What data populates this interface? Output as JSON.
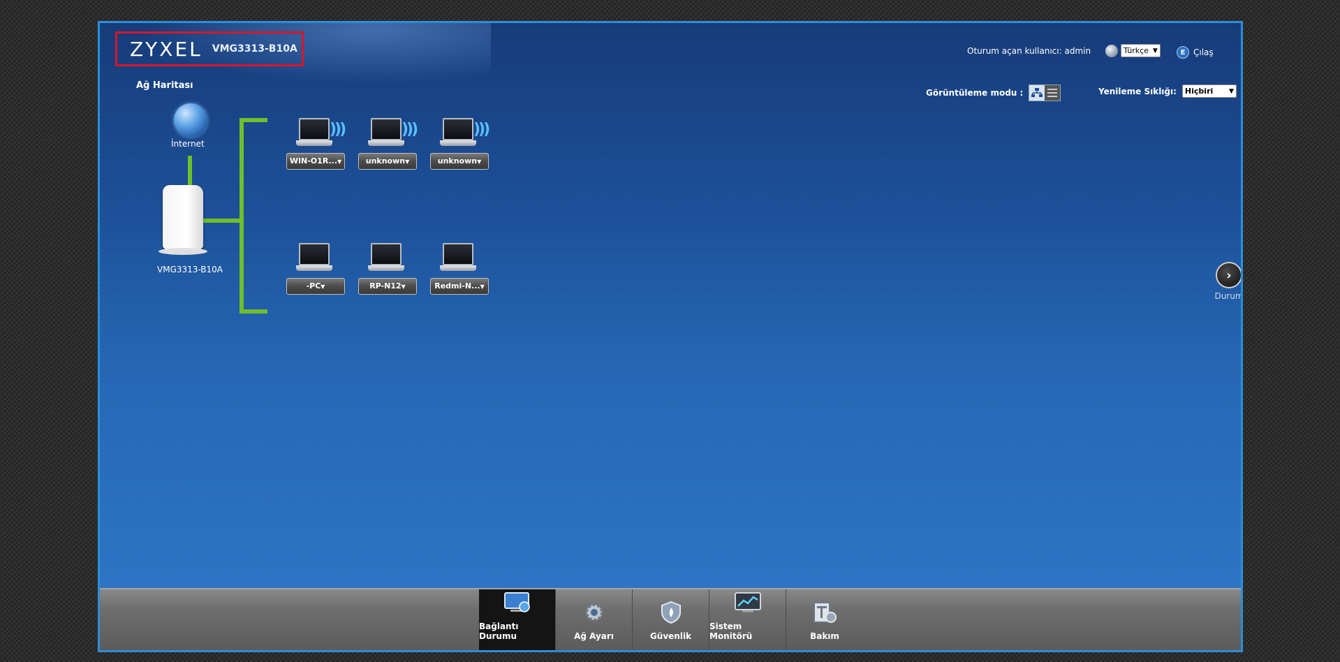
{
  "header": {
    "brand": "ZYXEL",
    "model": "VMG3313-B10A",
    "logged_in_text": "Oturum açan kullanıcı: admin",
    "language_selected": "Türkçe",
    "logout_label": "Çılaş"
  },
  "map": {
    "title": "Ağ Haritası",
    "view_mode_label": "Görüntüleme modu :",
    "refresh_label": "Yenileme Sıklığı:",
    "refresh_selected": "Hiçbiri",
    "internet_label": "İnternet",
    "router_label": "VMG3313-B10A",
    "wireless_devices": [
      "WIN-O1R...",
      "unknown",
      "unknown"
    ],
    "wired_devices": [
      "-PC",
      "RP-N12",
      "Redmi-N..."
    ]
  },
  "side": {
    "status_label": "Durum"
  },
  "nav": {
    "items": [
      {
        "label": "Bağlantı Durumu",
        "icon": "connection-status-icon"
      },
      {
        "label": "Ağ Ayarı",
        "icon": "gear-icon"
      },
      {
        "label": "Güvenlik",
        "icon": "shield-icon"
      },
      {
        "label": "Sistem Monitörü",
        "icon": "monitor-chart-icon"
      },
      {
        "label": "Bakım",
        "icon": "maintenance-icon"
      }
    ]
  },
  "colors": {
    "frame_border": "#2a8fd8",
    "logo_border": "#d8162a",
    "line_green": "#6ec02a"
  }
}
